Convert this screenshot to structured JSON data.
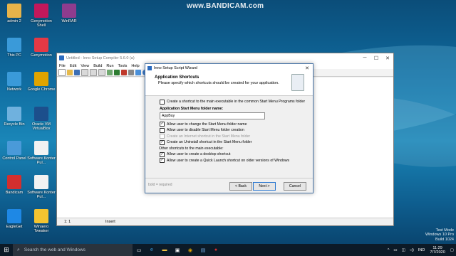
{
  "watermark": {
    "text": "www.BANDICAM.com"
  },
  "desktop_icons": [
    {
      "label": "admin 2",
      "icon": "user-folder-icon",
      "color": "#e6b34a"
    },
    {
      "label": "Genymotion Shell",
      "icon": "terminal-icon",
      "color": "#c2185b"
    },
    {
      "label": "WinRAR",
      "icon": "winrar-icon",
      "color": "#8e3c8e"
    },
    {
      "label": "This PC",
      "icon": "computer-icon",
      "color": "#3a9ad9"
    },
    {
      "label": "Genymotion",
      "icon": "genymotion-icon",
      "color": "#e53945"
    },
    {
      "label": "Network",
      "icon": "network-icon",
      "color": "#3a9ad9"
    },
    {
      "label": "Google Chrome",
      "icon": "chrome-icon",
      "color": "#e0a400"
    },
    {
      "label": "Recycle Bin",
      "icon": "recycle-bin-icon",
      "color": "#6fb1de"
    },
    {
      "label": "Oracle VM VirtualBox",
      "icon": "virtualbox-icon",
      "color": "#1c4f8c"
    },
    {
      "label": "Control Panel",
      "icon": "control-panel-icon",
      "color": "#4a9ad9"
    },
    {
      "label": "Software Konter Pul...",
      "icon": "document-icon",
      "color": "#f2f2f2"
    },
    {
      "label": "Bandicam",
      "icon": "bandicam-icon",
      "color": "#d32f2f"
    },
    {
      "label": "Software Konter Pul...",
      "icon": "document-icon",
      "color": "#f2f2f2"
    },
    {
      "label": "EagleGet",
      "icon": "eagleget-icon",
      "color": "#1e88e5"
    },
    {
      "label": "Winaero Tweaker",
      "icon": "winaero-icon",
      "color": "#f4c430"
    }
  ],
  "ide": {
    "title": "Untitled - Inno Setup Compiler 5.6.0 (a)",
    "menu": [
      "File",
      "Edit",
      "View",
      "Build",
      "Run",
      "Tools",
      "Help"
    ],
    "status": {
      "position": "1:   1",
      "mode": "Insert"
    }
  },
  "wizard": {
    "title": "Inno Setup Script Wizard",
    "header_title": "Application Shortcuts",
    "header_subtitle": "Please specify which shortcuts should be created for your application.",
    "opt_common_startmenu": {
      "label": "Create a shortcut to the main executable in the common Start Menu Programs folder",
      "checked": false
    },
    "folder_label": "Application Start Menu folder name:",
    "folder_value": "AppBuy",
    "opt_allow_change": {
      "label": "Allow user to change the Start Menu folder name",
      "checked": true
    },
    "opt_allow_disable": {
      "label": "Allow user to disable Start Menu folder creation",
      "checked": false
    },
    "opt_internet": {
      "label": "Create an Internet shortcut in the Start Menu folder",
      "checked": false
    },
    "opt_uninstall": {
      "label": "Create an Uninstall shortcut in the Start Menu folder",
      "checked": true
    },
    "other_label": "Other shortcuts to the main executable:",
    "opt_desktop": {
      "label": "Allow user to create a desktop shortcut",
      "checked": true
    },
    "opt_quicklaunch": {
      "label": "Allow user to create a Quick Launch shortcut on older versions of Windows",
      "checked": true
    },
    "footer_note": "bold = required",
    "back_label": "< Back",
    "next_label": "Next >",
    "cancel_label": "Cancel"
  },
  "taskbar": {
    "search_placeholder": "Search the web and Windows",
    "lang": "IND",
    "time": "11:29",
    "date": "7/7/2020"
  },
  "test_mode": {
    "line1": "Test Mode",
    "line2": "Windows 10 Pro",
    "line3": "Build 1024"
  }
}
